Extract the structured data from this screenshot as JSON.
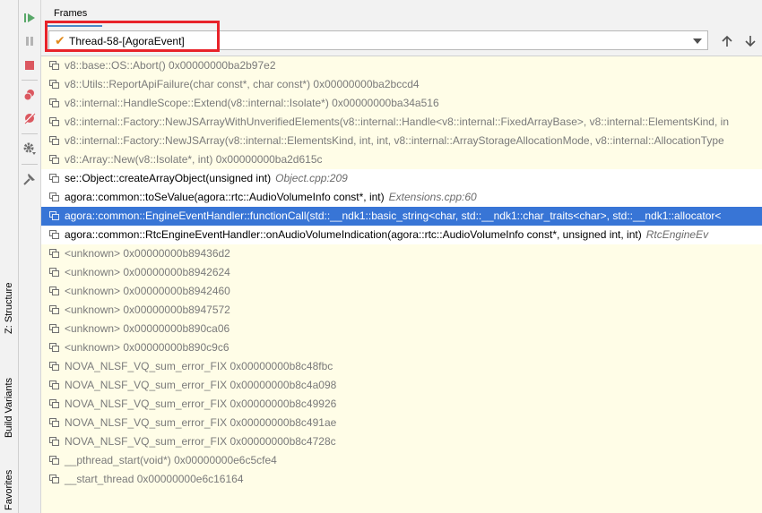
{
  "side_tabs": [
    {
      "label": "Z: Structure"
    },
    {
      "label": "Build Variants"
    },
    {
      "label": "Favorites"
    }
  ],
  "toolbar_icons": [
    "resume-icon",
    "pause-icon",
    "stop-icon",
    "view-breakpoints-icon",
    "mute-breakpoints-icon",
    "settings-icon",
    "pin-icon"
  ],
  "panel": {
    "tab_label": "Frames",
    "thread_selector": {
      "value": "Thread-58-[AgoraEvent]"
    }
  },
  "frames": [
    {
      "text": "v8::base::OS::Abort() 0x00000000ba2b97e2",
      "loc": "",
      "style": "dim"
    },
    {
      "text": "v8::Utils::ReportApiFailure(char const*, char const*) 0x00000000ba2bccd4",
      "loc": "",
      "style": "dim"
    },
    {
      "text": "v8::internal::HandleScope::Extend(v8::internal::Isolate*) 0x00000000ba34a516",
      "loc": "",
      "style": "dim"
    },
    {
      "text": "v8::internal::Factory::NewJSArrayWithUnverifiedElements(v8::internal::Handle<v8::internal::FixedArrayBase>, v8::internal::ElementsKind, in",
      "loc": "",
      "style": "dim"
    },
    {
      "text": "v8::internal::Factory::NewJSArray(v8::internal::ElementsKind, int, int, v8::internal::ArrayStorageAllocationMode, v8::internal::AllocationType",
      "loc": "",
      "style": "dim"
    },
    {
      "text": "v8::Array::New(v8::Isolate*, int) 0x00000000ba2d615c",
      "loc": "",
      "style": "dim"
    },
    {
      "text": "se::Object::createArrayObject(unsigned int)",
      "loc": "Object.cpp:209",
      "style": "normal"
    },
    {
      "text": "agora::common::toSeValue(agora::rtc::AudioVolumeInfo const*, int)",
      "loc": "Extensions.cpp:60",
      "style": "normal"
    },
    {
      "text": "agora::common::EngineEventHandler::functionCall(std::__ndk1::basic_string<char, std::__ndk1::char_traits<char>, std::__ndk1::allocator<",
      "loc": "",
      "style": "selected"
    },
    {
      "text": "agora::common::RtcEngineEventHandler::onAudioVolumeIndication(agora::rtc::AudioVolumeInfo const*, unsigned int, int)",
      "loc": "RtcEngineEv",
      "style": "normal"
    },
    {
      "text": "<unknown> 0x00000000b89436d2",
      "loc": "",
      "style": "dim"
    },
    {
      "text": "<unknown> 0x00000000b8942624",
      "loc": "",
      "style": "dim"
    },
    {
      "text": "<unknown> 0x00000000b8942460",
      "loc": "",
      "style": "dim"
    },
    {
      "text": "<unknown> 0x00000000b8947572",
      "loc": "",
      "style": "dim"
    },
    {
      "text": "<unknown> 0x00000000b890ca06",
      "loc": "",
      "style": "dim"
    },
    {
      "text": "<unknown> 0x00000000b890c9c6",
      "loc": "",
      "style": "dim"
    },
    {
      "text": "NOVA_NLSF_VQ_sum_error_FIX 0x00000000b8c48fbc",
      "loc": "",
      "style": "dim"
    },
    {
      "text": "NOVA_NLSF_VQ_sum_error_FIX 0x00000000b8c4a098",
      "loc": "",
      "style": "dim"
    },
    {
      "text": "NOVA_NLSF_VQ_sum_error_FIX 0x00000000b8c49926",
      "loc": "",
      "style": "dim"
    },
    {
      "text": "NOVA_NLSF_VQ_sum_error_FIX 0x00000000b8c491ae",
      "loc": "",
      "style": "dim"
    },
    {
      "text": "NOVA_NLSF_VQ_sum_error_FIX 0x00000000b8c4728c",
      "loc": "",
      "style": "dim"
    },
    {
      "text": "__pthread_start(void*) 0x00000000e6c5cfe4",
      "loc": "",
      "style": "dim"
    },
    {
      "text": "__start_thread 0x00000000e6c16164",
      "loc": "",
      "style": "dim"
    }
  ]
}
